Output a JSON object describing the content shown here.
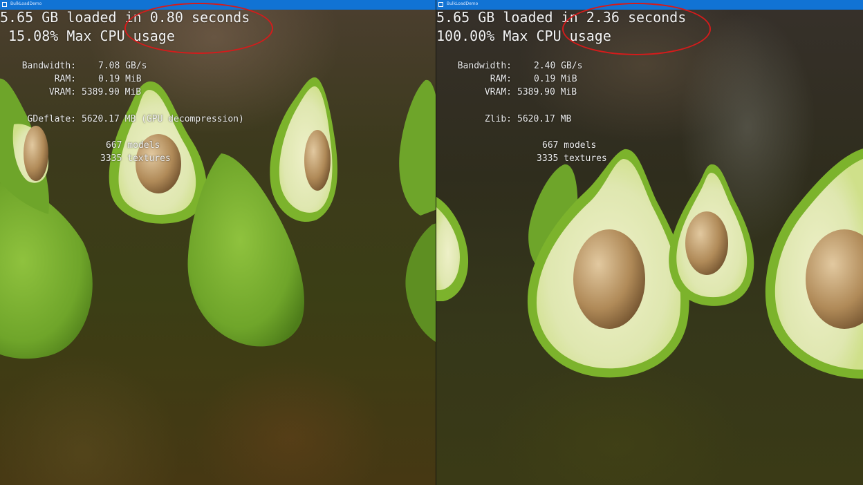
{
  "left": {
    "window_title": "BulkLoadDemo",
    "loaded_text": "5.65 GB loaded in 0.80 seconds",
    "cpu_text": " 15.08% Max CPU usage",
    "stats": {
      "bandwidth": {
        "label": "Bandwidth:",
        "value": "7.08 GB/s"
      },
      "ram": {
        "label": "RAM:",
        "value": "0.19 MiB"
      },
      "vram": {
        "label": "VRAM:",
        "value": "5389.90 MiB"
      },
      "decompression": {
        "label": "GDeflate:",
        "value": "5620.17 MB (GPU decompression)"
      },
      "models": "667 models",
      "textures": "3335 textures"
    }
  },
  "right": {
    "window_title": "BulkLoadDemo",
    "loaded_text": "5.65 GB loaded in 2.36 seconds",
    "cpu_text": "100.00% Max CPU usage",
    "stats": {
      "bandwidth": {
        "label": "Bandwidth:",
        "value": "2.40 GB/s"
      },
      "ram": {
        "label": "RAM:",
        "value": "0.19 MiB"
      },
      "vram": {
        "label": "VRAM:",
        "value": "5389.90 MiB"
      },
      "decompression": {
        "label": "Zlib:",
        "value": "5620.17 MB"
      },
      "models": "667 models",
      "textures": "3335 textures"
    }
  },
  "colors": {
    "titlebar": "#1173d4",
    "highlight_circle": "#d51b1b",
    "avocado_skin": "#7cb32c",
    "avocado_flesh": "#dfe7b0",
    "avocado_pit": "#b08a58"
  },
  "icons": [
    "app-window-icon",
    "app-window-icon"
  ]
}
